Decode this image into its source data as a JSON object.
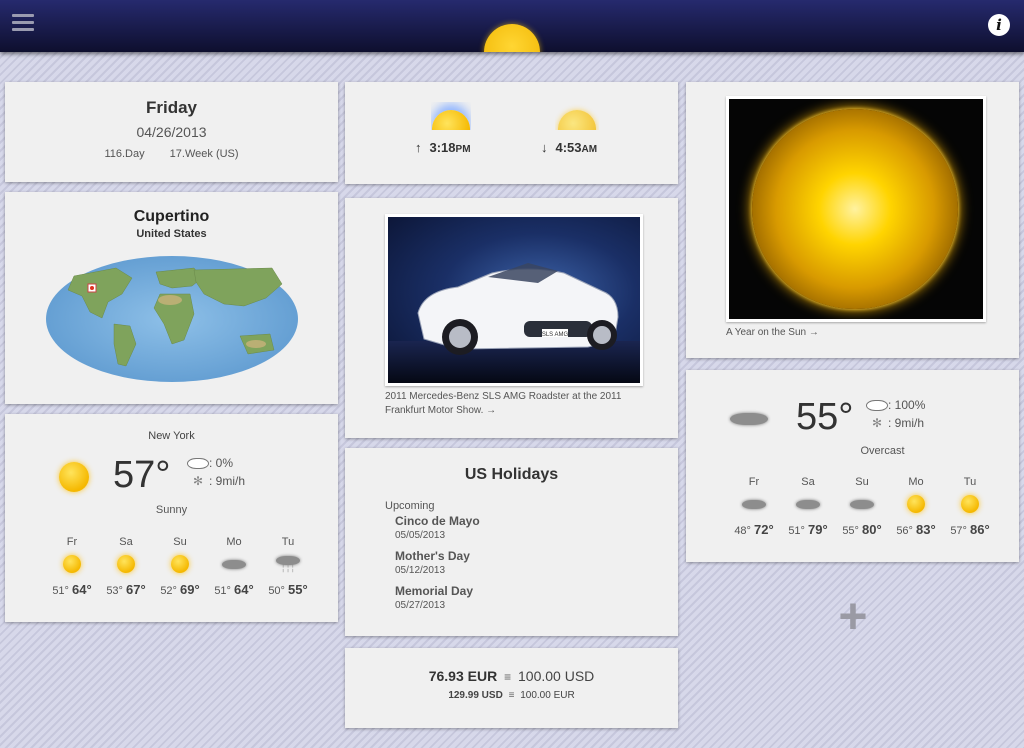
{
  "date_card": {
    "day": "Friday",
    "date": "04/26/2013",
    "day_of_year": "116.Day",
    "week": "17.Week (US)"
  },
  "sun_times": {
    "sunrise_arrow": "↑",
    "sunrise_time": "3:18",
    "sunrise_suffix": "PM",
    "sunset_arrow": "↓",
    "sunset_time": "4:53",
    "sunset_suffix": "AM"
  },
  "location": {
    "city": "Cupertino",
    "country": "United States"
  },
  "car_card": {
    "caption": "2011 Mercedes-Benz SLS AMG Roadster at the 2011 Frankfurt Motor Show. →",
    "plate": "SLS AMG"
  },
  "sun_photo": {
    "caption": "A Year on the Sun →"
  },
  "weather_ny": {
    "city": "New York",
    "temp": "57°",
    "precip": ": 0%",
    "wind": ": 9mi/h",
    "condition": "Sunny",
    "forecast": [
      {
        "day": "Fr",
        "icon": "sun-icon",
        "low": "51°",
        "high": "64°"
      },
      {
        "day": "Sa",
        "icon": "sun-icon",
        "low": "53°",
        "high": "67°"
      },
      {
        "day": "Su",
        "icon": "sun-icon",
        "low": "52°",
        "high": "69°"
      },
      {
        "day": "Mo",
        "icon": "cloud-icon",
        "low": "51°",
        "high": "64°"
      },
      {
        "day": "Tu",
        "icon": "rain-cloud-icon",
        "low": "50°",
        "high": "55°"
      }
    ]
  },
  "weather_local": {
    "temp": "55°",
    "precip": ": 100%",
    "wind": ": 9mi/h",
    "condition": "Overcast",
    "forecast": [
      {
        "day": "Fr",
        "icon": "cloud-icon",
        "low": "48°",
        "high": "72°"
      },
      {
        "day": "Sa",
        "icon": "cloud-icon",
        "low": "51°",
        "high": "79°"
      },
      {
        "day": "Su",
        "icon": "cloud-icon",
        "low": "55°",
        "high": "80°"
      },
      {
        "day": "Mo",
        "icon": "sun-icon",
        "low": "56°",
        "high": "83°"
      },
      {
        "day": "Tu",
        "icon": "sun-icon",
        "low": "57°",
        "high": "86°"
      }
    ]
  },
  "holidays": {
    "title": "US Holidays",
    "section": "Upcoming",
    "items": [
      {
        "name": "Cinco de Mayo",
        "date": "05/05/2013"
      },
      {
        "name": "Mother's Day",
        "date": "05/12/2013"
      },
      {
        "name": "Memorial Day",
        "date": "05/27/2013"
      }
    ]
  },
  "currency": {
    "line1_amount": "76.93 EUR",
    "line1_equiv": "≡",
    "line1_target": "100.00 USD",
    "line2_amount": "129.99 USD",
    "line2_equiv": "≡",
    "line2_target": "100.00 EUR"
  },
  "toolbar": {
    "info_label": "i",
    "add_label": "+"
  },
  "colors": {
    "topbar": "#1c1f55",
    "sun": "#f5b800",
    "card": "#f0f0f0"
  }
}
